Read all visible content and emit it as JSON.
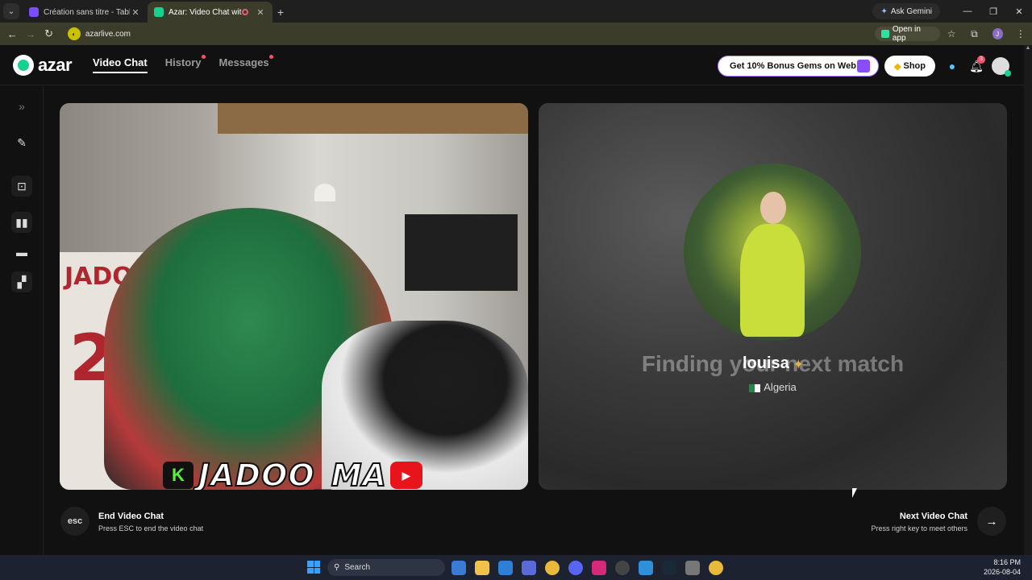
{
  "browser": {
    "tabs": [
      {
        "title": "Création sans titre - Tableau bla",
        "active": false
      },
      {
        "title": "Azar: Video Chat with New",
        "active": true
      }
    ],
    "ask_gemini": "Ask Gemini",
    "url": "azarlive.com",
    "open_in_app": "Open in app"
  },
  "app": {
    "logo": "azar",
    "nav": [
      {
        "label": "Video Chat",
        "active": true,
        "dot": false
      },
      {
        "label": "History",
        "active": false,
        "dot": true
      },
      {
        "label": "Messages",
        "active": false,
        "dot": true
      }
    ],
    "promo": "Get 10% Bonus Gems on Web!",
    "shop": "Shop",
    "notification_count": "3"
  },
  "local_video": {
    "watermark": "JADOO_MA",
    "jersey_name": "JADOO",
    "jersey_number": "20"
  },
  "remote_video": {
    "status": "Finding your next match",
    "name": "louisa",
    "country": "Algeria"
  },
  "controls": {
    "esc_label": "esc",
    "end_title": "End Video Chat",
    "end_subtitle": "Press ESC to end the video chat",
    "next_title": "Next Video Chat",
    "next_subtitle": "Press right key to meet others"
  },
  "taskbar": {
    "search_placeholder": "Search",
    "time": "8:16 PM",
    "date": "2026-08-04"
  },
  "colors": {
    "accent": "#19d18f",
    "notification": "#ff4e6a",
    "promo_border": "#b17cff"
  }
}
